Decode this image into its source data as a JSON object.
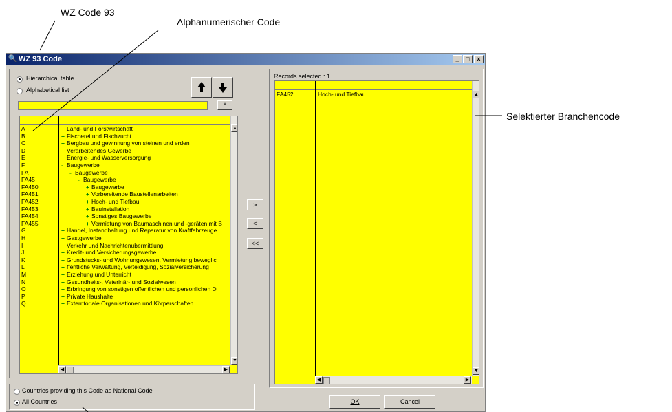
{
  "annotations": {
    "wz_code": "WZ Code 93",
    "alphanumeric": "Alphanumerischer Code",
    "selected_code": "Selektierter Branchencode"
  },
  "window": {
    "title": "WZ 93 Code",
    "title_icon": "magnifier-icon",
    "controls": [
      "_",
      "□",
      "×"
    ]
  },
  "view_options": {
    "hierarchical": "Hierarchical table",
    "alphabetical": "Alphabetical list",
    "selected": "hierarchical"
  },
  "search": {
    "value": "",
    "clear_label": "*"
  },
  "move_buttons": {
    "up_icon": "move-up-icon",
    "down_icon": "move-down-icon"
  },
  "tree": [
    {
      "code": "A",
      "text": "Land- und Forstwirtschaft",
      "level": 0,
      "mark": "+"
    },
    {
      "code": "B",
      "text": "Fischerei und Fischzucht",
      "level": 0,
      "mark": "+"
    },
    {
      "code": "C",
      "text": "Bergbau und gewinnung von steinen und erden",
      "level": 0,
      "mark": "+"
    },
    {
      "code": "D",
      "text": "Verarbeitendes Gewerbe",
      "level": 0,
      "mark": "+"
    },
    {
      "code": "E",
      "text": "Energie- und Wasserversorgung",
      "level": 0,
      "mark": "+"
    },
    {
      "code": "F",
      "text": "Baugewerbe",
      "level": 0,
      "mark": "-"
    },
    {
      "code": "FA",
      "text": "Baugewerbe",
      "level": 1,
      "mark": "-"
    },
    {
      "code": "FA45",
      "text": "Baugewerbe",
      "level": 2,
      "mark": "-"
    },
    {
      "code": "FA450",
      "text": "Baugewerbe",
      "level": 3,
      "mark": "+"
    },
    {
      "code": "FA451",
      "text": "Vorbereitende Baustellenarbeiten",
      "level": 3,
      "mark": "+"
    },
    {
      "code": "FA452",
      "text": "Hoch- und Tiefbau",
      "level": 3,
      "mark": "+"
    },
    {
      "code": "FA453",
      "text": "Bauinstallation",
      "level": 3,
      "mark": "+"
    },
    {
      "code": "FA454",
      "text": "Sonstiges Baugewerbe",
      "level": 3,
      "mark": "+"
    },
    {
      "code": "FA455",
      "text": "Vermietung von Baumaschinen und -geräten mit B",
      "level": 3,
      "mark": "+"
    },
    {
      "code": "G",
      "text": "Handel, Instandhaltung und Reparatur von Kraftfahrzeuge",
      "level": 0,
      "mark": "+"
    },
    {
      "code": "H",
      "text": "Gastgewerbe",
      "level": 0,
      "mark": "+"
    },
    {
      "code": "I",
      "text": "Verkehr und Nachrichtenubermittlung",
      "level": 0,
      "mark": "+"
    },
    {
      "code": "J",
      "text": "Kredit- und Versicherungsgewerbe",
      "level": 0,
      "mark": "+"
    },
    {
      "code": "K",
      "text": "Grundstucks- und Wohnungswesen, Vermietung beweglic",
      "level": 0,
      "mark": "+"
    },
    {
      "code": "L",
      "text": "ffentliche Verwaltung, Verteidigung, Sozialversicherung",
      "level": 0,
      "mark": "+"
    },
    {
      "code": "M",
      "text": "Erziehung und Unterricht",
      "level": 0,
      "mark": "+"
    },
    {
      "code": "N",
      "text": "Gesundheits-, Veterinär- und Sozialwesen",
      "level": 0,
      "mark": "+"
    },
    {
      "code": "O",
      "text": "Erbringung von sonstigen offentlichen und personlichen Di",
      "level": 0,
      "mark": "+"
    },
    {
      "code": "P",
      "text": "Private Haushalte",
      "level": 0,
      "mark": "+"
    },
    {
      "code": "Q",
      "text": "Exterritoriale Organisationen und Körperschaften",
      "level": 0,
      "mark": "+"
    }
  ],
  "transfer_buttons": {
    "add": ">",
    "remove": "<",
    "remove_all": "<<"
  },
  "records": {
    "label": "Records selected : 1",
    "rows": [
      {
        "code": "FA452",
        "text": "Hoch- und Tiefbau"
      }
    ]
  },
  "country_options": {
    "national": "Countries providing this Code as National Code",
    "all": "All Countries",
    "selected": "all"
  },
  "ok_button": {
    "label": "OK"
  },
  "cancel_button": {
    "label": "Cancel"
  },
  "colors": {
    "list_bg": "#ffff00",
    "window_bg": "#d4d0c8",
    "tree_marker": "#008000"
  }
}
